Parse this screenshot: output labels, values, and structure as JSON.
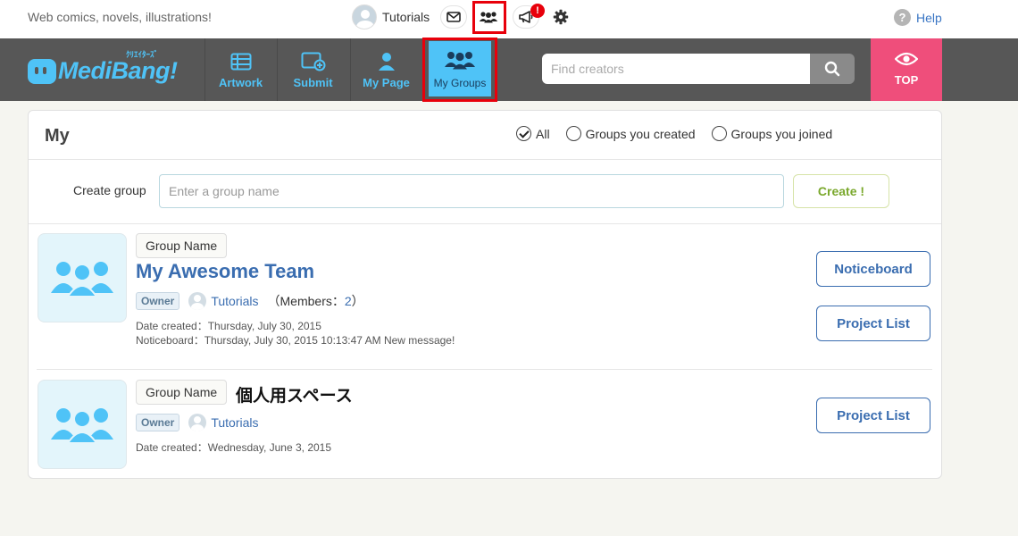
{
  "topbar": {
    "tagline": "Web comics, novels, illustrations!",
    "username": "Tutorials",
    "notification_count": "!",
    "help_label": "Help",
    "help_symbol": "?",
    "icons": [
      "mail-icon",
      "groups-icon",
      "megaphone-icon",
      "gear-icon"
    ]
  },
  "brand": {
    "logo_text": "MediBang!",
    "logo_kana": "ｸﾘｴｲﾀｰｽﾞ",
    "accent_color": "#4fc3f7",
    "top_button_color": "#ef4e7b"
  },
  "nav": {
    "items": [
      {
        "label": "Artwork",
        "icon": "artwork-icon"
      },
      {
        "label": "Submit",
        "icon": "submit-icon"
      },
      {
        "label": "My Page",
        "icon": "person-icon"
      },
      {
        "label": "My Groups",
        "icon": "groups-icon",
        "active": true
      }
    ],
    "search_placeholder": "Find creators",
    "top_label": "TOP"
  },
  "page": {
    "title": "My",
    "filters": [
      {
        "label": "All",
        "checked": true
      },
      {
        "label": "Groups you created",
        "checked": false
      },
      {
        "label": "Groups you joined",
        "checked": false
      }
    ],
    "create_label": "Create group",
    "create_placeholder": "Enter a group name",
    "create_button": "Create !"
  },
  "groups": [
    {
      "tag": "Group Name",
      "name": "My Awesome Team",
      "role": "Owner",
      "owner": "Tutorials",
      "members_prefix": "（Members：",
      "members_count": "2",
      "members_suffix": "）",
      "date_created": "Date created：Thursday, July 30, 2015",
      "noticeboard": "Noticeboard：Thursday, July 30, 2015 10:13:47 AM New message!",
      "buttons": [
        "Noticeboard",
        "Project List"
      ]
    },
    {
      "tag": "Group Name",
      "name": "個人用スペース",
      "role": "Owner",
      "owner": "Tutorials",
      "date_created": "Date created：Wednesday, June 3, 2015",
      "buttons": [
        "Project List"
      ]
    }
  ]
}
